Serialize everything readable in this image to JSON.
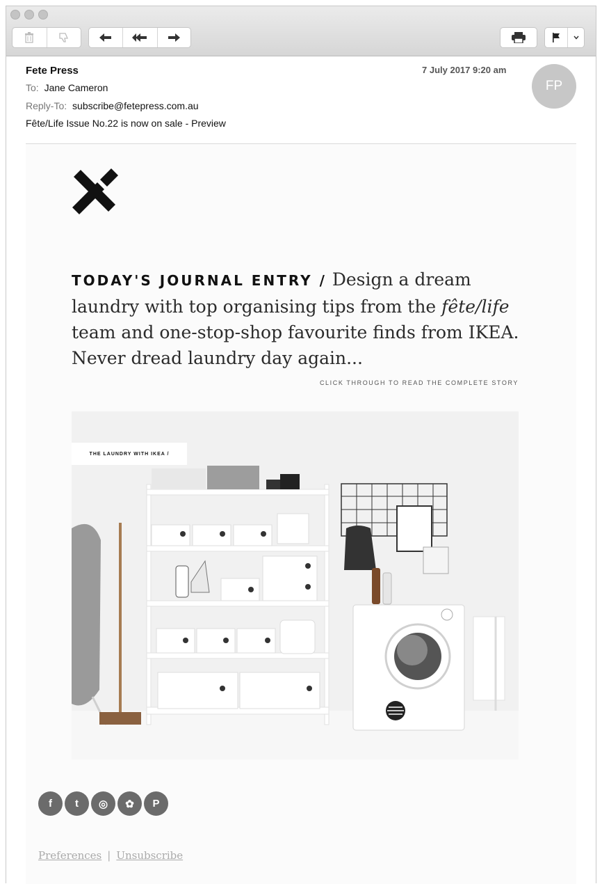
{
  "toolbar": {
    "traffic_lights": [
      "close",
      "minimize",
      "zoom"
    ],
    "icons": {
      "delete": "trash-icon",
      "junk": "thumbs-down-icon",
      "reply": "reply-icon",
      "reply_all": "reply-all-icon",
      "forward": "forward-icon",
      "print": "printer-icon",
      "flag": "flag-icon",
      "flag_menu": "chevron-down-icon"
    }
  },
  "message": {
    "from": "Fete Press",
    "date": "7 July 2017 9:20 am",
    "to_label": "To:",
    "to": "Jane Cameron",
    "reply_to_label": "Reply-To:",
    "reply_to": "subscribe@fetepress.com.au",
    "subject": "Fête/Life Issue No.22 is now on sale - Preview",
    "avatar_initials": "FP"
  },
  "email": {
    "journal_heading": "TODAY'S JOURNAL ENTRY /",
    "journal_text_1": " Design a dream laundry with top organising tips from the ",
    "journal_emphasis": "fête/life",
    "journal_text_2": " team and one-stop-shop favourite finds from IKEA. Never dread laundry day again...",
    "read_more": "CLICK THROUGH TO READ THE COMPLETE STORY",
    "image_label": "THE LAUNDRY WITH IKEA /",
    "social": [
      {
        "name": "facebook-icon",
        "glyph": "f"
      },
      {
        "name": "twitter-icon",
        "glyph": "t"
      },
      {
        "name": "instagram-icon",
        "glyph": "◎"
      },
      {
        "name": "website-icon",
        "glyph": "✿"
      },
      {
        "name": "pinterest-icon",
        "glyph": "P"
      }
    ],
    "footer": {
      "preferences": "Preferences",
      "separator": "|",
      "unsubscribe": "Unsubscribe"
    }
  },
  "colors": {
    "avatar": "#c7c7c7",
    "social_icon": "#6b6b6b",
    "footer_link": "#aaaaaa"
  }
}
